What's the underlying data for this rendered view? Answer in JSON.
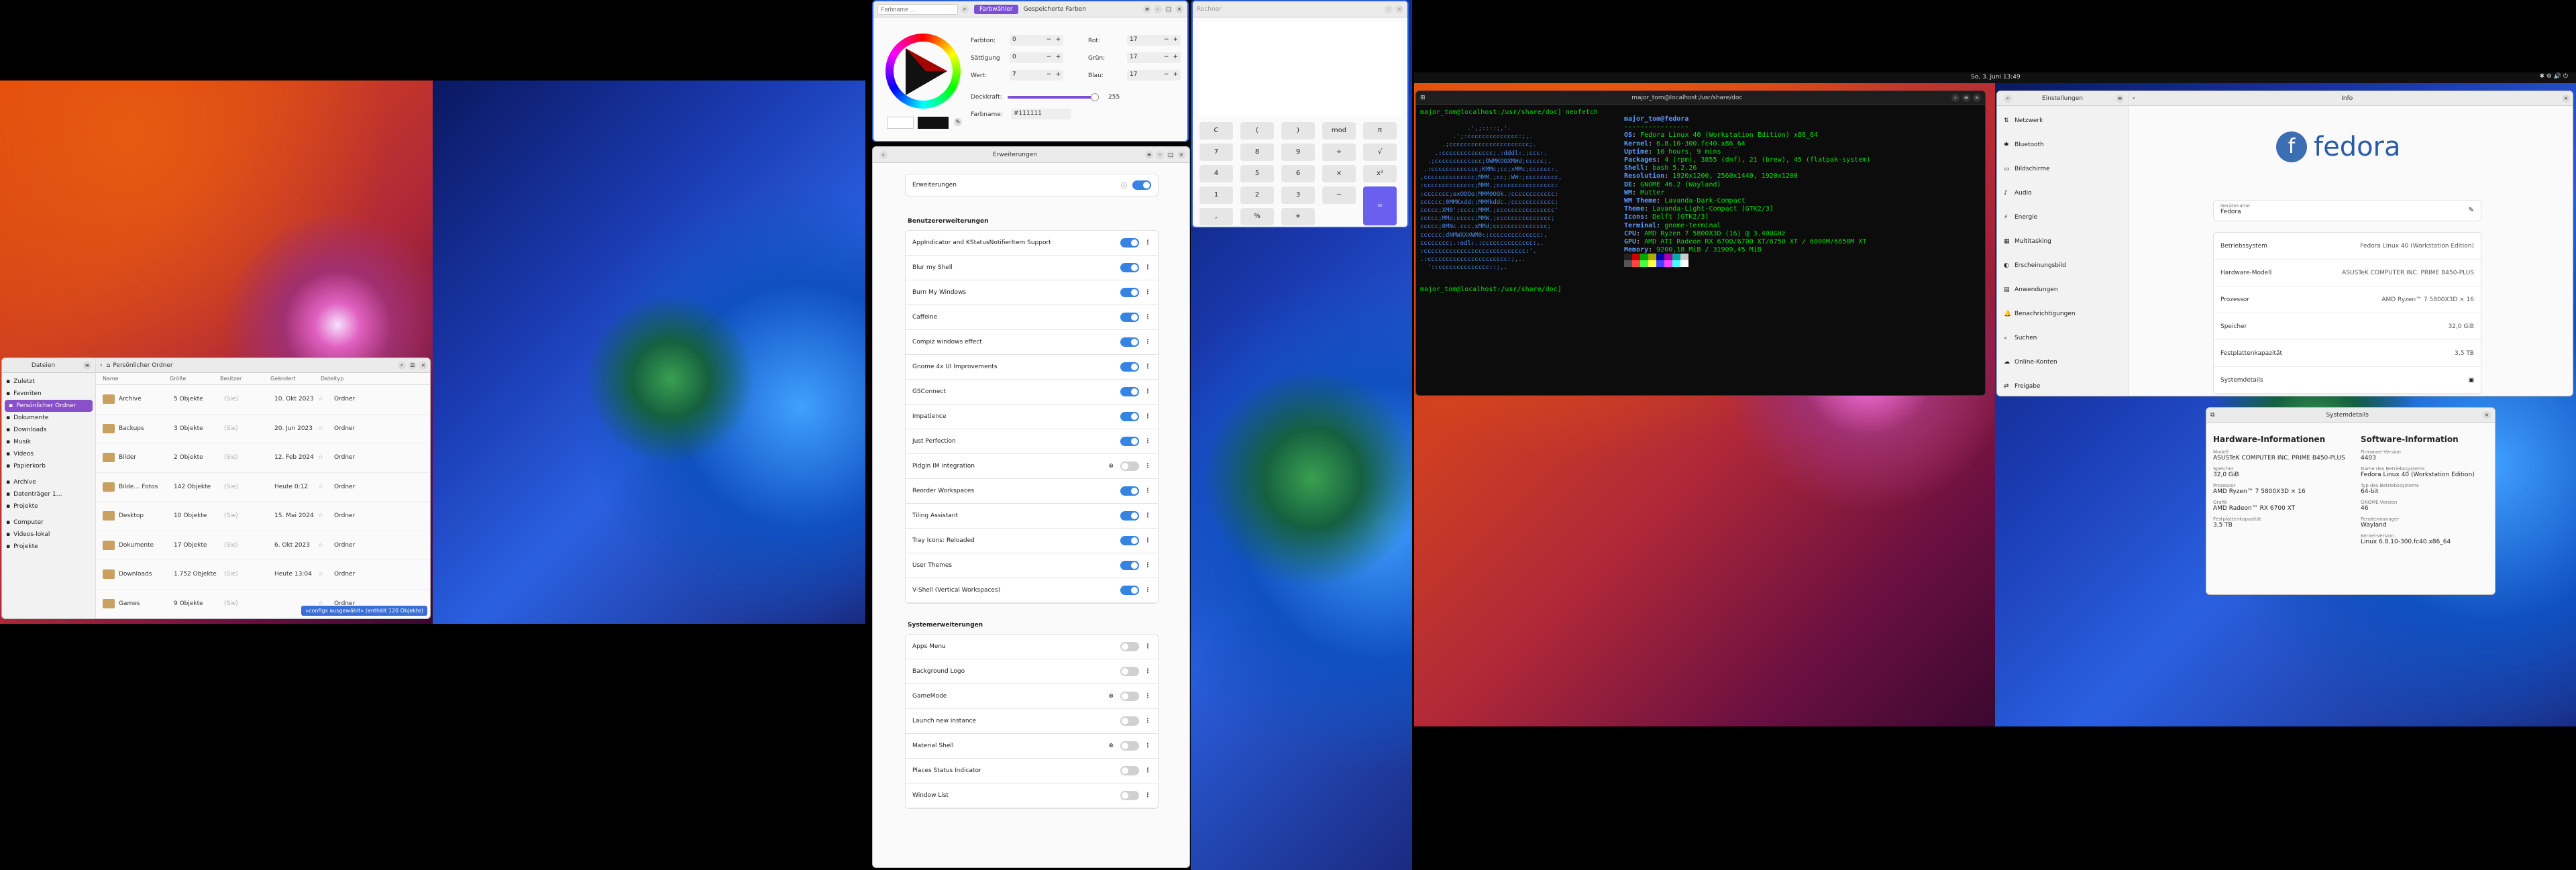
{
  "files": {
    "sidebar_title": "Dateien",
    "path": "Persönlicher Ordner",
    "sidebar": [
      "Zuletzt",
      "Favoriten",
      "Persönlicher Ordner",
      "Dokumente",
      "Downloads",
      "Musik",
      "Videos",
      "Papierkorb",
      "Archive",
      "Datenträger 1…",
      "Projekte",
      "Computer",
      "Videos-lokal",
      "Projekte"
    ],
    "columns": [
      "Name",
      "Größe",
      "Besitzer",
      "Geändert",
      "Dateityp"
    ],
    "rows": [
      {
        "name": "Archive",
        "size": "5 Objekte",
        "date": "10. Okt 2023",
        "type": "Ordner"
      },
      {
        "name": "Backups",
        "size": "3 Objekte",
        "date": "20. Jun 2023",
        "type": "Ordner"
      },
      {
        "name": "Bilder",
        "size": "2 Objekte",
        "date": "12. Feb 2024",
        "type": "Ordner"
      },
      {
        "name": "Bilde… Fotos",
        "size": "142 Objekte",
        "date": "Heute 0:12",
        "type": "Ordner"
      },
      {
        "name": "Desktop",
        "size": "10 Objekte",
        "date": "15. Mai 2024",
        "type": "Ordner"
      },
      {
        "name": "Dokumente",
        "size": "17 Objekte",
        "date": "6. Okt 2023",
        "type": "Ordner"
      },
      {
        "name": "Downloads",
        "size": "1.752 Objekte",
        "date": "Heute 13:04",
        "type": "Ordner"
      },
      {
        "name": "Games",
        "size": "9 Objekte",
        "date": "",
        "type": "Ordner"
      }
    ],
    "owner": "(Sie)",
    "status": "»configs ausgewählt« (enthält 120 Objekte)"
  },
  "picker": {
    "placeholder": "Farbname …",
    "tab1": "Farbwähler",
    "tab2": "Gespeicherte Farben",
    "labels": {
      "hue": "Farbton:",
      "sat": "Sättigung",
      "val": "Wert:",
      "red": "Rot:",
      "green": "Grün:",
      "blue": "Blau:",
      "alpha": "Deckkraft:",
      "name": "Farbname:"
    },
    "values": {
      "hue": "0",
      "sat": "0",
      "val": "7",
      "red": "17",
      "green": "17",
      "blue": "17",
      "alpha": "255",
      "name": "#111111"
    }
  },
  "calc": {
    "title": "Rechner",
    "buttons": [
      "C",
      "(",
      ")",
      "mod",
      "π",
      "7",
      "8",
      "9",
      "÷",
      "√",
      "4",
      "5",
      "6",
      "×",
      "x²",
      "1",
      "2",
      "3",
      "−",
      "0",
      ",",
      "%",
      "+",
      "="
    ]
  },
  "ext": {
    "title": "Erweiterungen",
    "top_label": "Erweiterungen",
    "user_header": "Benutzererweiterungen",
    "user": [
      {
        "name": "AppIndicator and KStatusNotifierItem Support",
        "on": true
      },
      {
        "name": "Blur my Shell",
        "on": true
      },
      {
        "name": "Burn My Windows",
        "on": true
      },
      {
        "name": "Caffeine",
        "on": true
      },
      {
        "name": "Compiz windows effect",
        "on": true
      },
      {
        "name": "Gnome 4x UI Improvements",
        "on": true
      },
      {
        "name": "GSConnect",
        "on": true
      },
      {
        "name": "Impatience",
        "on": true
      },
      {
        "name": "Just Perfection",
        "on": true
      },
      {
        "name": "Pidgin IM integration",
        "on": false
      },
      {
        "name": "Reorder Workspaces",
        "on": true
      },
      {
        "name": "Tiling Assistant",
        "on": true
      },
      {
        "name": "Tray Icons: Reloaded",
        "on": true
      },
      {
        "name": "User Themes",
        "on": true
      },
      {
        "name": "V-Shell (Vertical Workspaces)",
        "on": true
      }
    ],
    "sys_header": "Systemerweiterungen",
    "sys": [
      {
        "name": "Apps Menu",
        "on": false
      },
      {
        "name": "Background Logo",
        "on": false
      },
      {
        "name": "GameMode",
        "on": false
      },
      {
        "name": "Launch new instance",
        "on": false
      },
      {
        "name": "Material Shell",
        "on": false
      },
      {
        "name": "Places Status Indicator",
        "on": false
      },
      {
        "name": "Window List",
        "on": false
      }
    ]
  },
  "topbar": {
    "clock": "So, 3. Juni 13:49"
  },
  "terminal": {
    "title": "major_tom@localhost:/usr/share/doc",
    "prompt1": "major_tom@localhost:/usr/share/doc] neofetch",
    "userhost": "major_tom@fedora",
    "info": [
      [
        "OS",
        "Fedora Linux 40 (Workstation Edition) x86_64"
      ],
      [
        "Kernel",
        "6.8.10-300.fc40.x86_64"
      ],
      [
        "Uptime",
        "10 hours, 9 mins"
      ],
      [
        "Packages",
        "4 (rpm), 3855 (dnf), 21 (brew), 45 (flatpak-system)"
      ],
      [
        "Shell",
        "bash 5.2.26"
      ],
      [
        "Resolution",
        "1920x1200, 2560x1440, 1920x1200"
      ],
      [
        "DE",
        "GNOME 46.2 (Wayland)"
      ],
      [
        "WM",
        "Mutter"
      ],
      [
        "WM Theme",
        "Lavanda-Dark-Compact"
      ],
      [
        "Theme",
        "Lavanda-Light-Compact [GTK2/3]"
      ],
      [
        "Icons",
        "Delft [GTK2/3]"
      ],
      [
        "Terminal",
        "gnome-terminal"
      ],
      [
        "CPU",
        "AMD Ryzen 7 5800X3D (16) @ 3.400GHz"
      ],
      [
        "GPU",
        "AMD ATI Radeon RX 6700/6700 XT/6750 XT / 6800M/6850M XT"
      ],
      [
        "Memory",
        "9200,18 MiB / 31909,45 MiB"
      ]
    ],
    "prompt2": "major_tom@localhost:/usr/share/doc]"
  },
  "settings": {
    "title": "Einstellungen",
    "panel_title": "Info",
    "items": [
      "Netzwerk",
      "Bluetooth",
      "Bildschirme",
      "Audio",
      "Energie",
      "Multitasking",
      "Erscheinungsbild",
      "Anwendungen",
      "Benachrichtigungen",
      "Suchen",
      "Online-Konten",
      "Freigabe"
    ],
    "logo": "fedora",
    "device_label": "Gerätename",
    "device": "Fedora",
    "rows": [
      [
        "Betriebssystem",
        "Fedora Linux 40 (Workstation Edition)"
      ],
      [
        "Hardware-Modell",
        "ASUSTeK COMPUTER INC. PRIME B450-PLUS"
      ],
      [
        "Prozessor",
        "AMD Ryzen™ 7 5800X3D × 16"
      ],
      [
        "Speicher",
        "32,0 GiB"
      ],
      [
        "Festplattenkapazität",
        "3,5 TB"
      ],
      [
        "Systemdetails",
        ""
      ]
    ]
  },
  "sysinfo": {
    "title": "Systemdetails",
    "hw_title": "Hardware-Informationen",
    "sw_title": "Software-Information",
    "hw": [
      [
        "Modell",
        "ASUSTeK COMPUTER INC. PRIME B450-PLUS"
      ],
      [
        "Speicher",
        "32,0 GiB"
      ],
      [
        "Prozessor",
        "AMD Ryzen™ 7 5800X3D × 16"
      ],
      [
        "Grafik",
        "AMD Radeon™ RX 6700 XT"
      ],
      [
        "Festplattenkapazität",
        "3,5 TB"
      ]
    ],
    "sw": [
      [
        "Firmware-Version",
        "4403"
      ],
      [
        "Name des Betriebssystems",
        "Fedora Linux 40 (Workstation Edition)"
      ],
      [
        "Typ des Betriebssystems",
        "64-bit"
      ],
      [
        "GNOME-Version",
        "46"
      ],
      [
        "Fenstermanager",
        "Wayland"
      ],
      [
        "Kernel-Version",
        "Linux 6.8.10-300.fc40.x86_64"
      ]
    ]
  }
}
